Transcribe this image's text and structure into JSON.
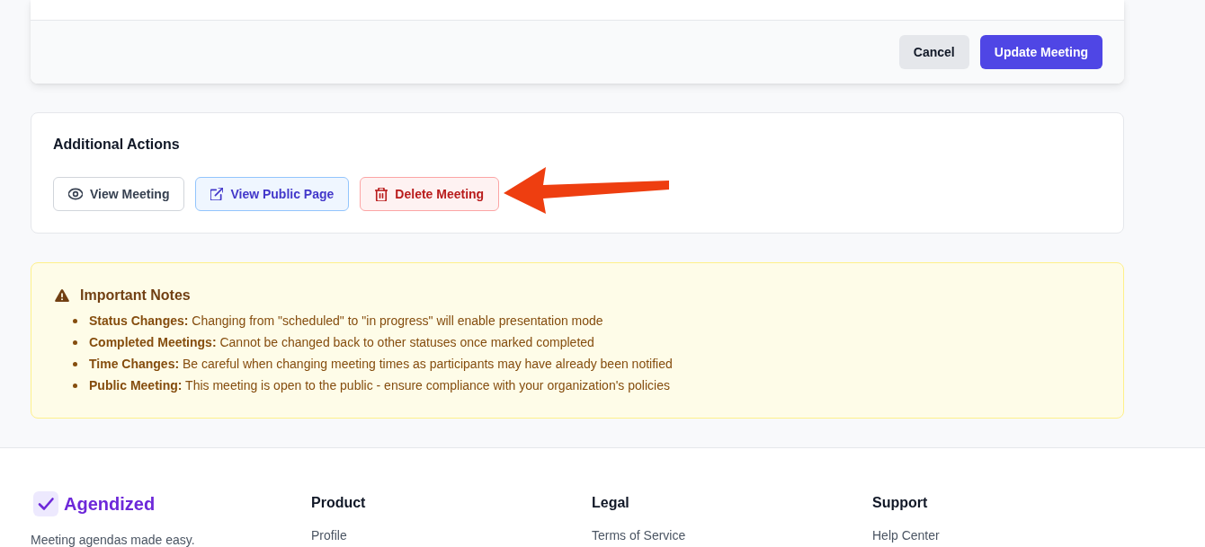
{
  "form_card": {
    "buttons": [
      {
        "label": "Cancel",
        "kind": "secondary"
      },
      {
        "label": "Update Meeting",
        "kind": "primary"
      }
    ]
  },
  "additional_actions": {
    "title": "Additional Actions",
    "buttons": [
      {
        "label": "View Meeting",
        "kind": "view"
      },
      {
        "label": "View Public Page",
        "kind": "public"
      },
      {
        "label": "Delete Meeting",
        "kind": "delete"
      }
    ]
  },
  "important_notes": {
    "title": "Important Notes",
    "items": [
      "**Status Changes:** Changing from \"scheduled\" to \"in progress\" will enable presentation mode",
      "**Completed Meetings:** Cannot be changed back to other statuses once marked completed",
      "**Time Changes:** Be careful when changing meeting times as participants may have already been notified",
      "**Public Meeting:** This meeting is open to the public - ensure compliance with your organization's policies"
    ]
  },
  "footer": {
    "brand": {
      "name": "Agendized",
      "tagline": "Meeting agendas made easy."
    },
    "columns": [
      {
        "heading": "Product",
        "links": [
          "Profile"
        ]
      },
      {
        "heading": "Legal",
        "links": [
          "Terms of Service"
        ]
      },
      {
        "heading": "Support",
        "links": [
          "Help Center"
        ]
      }
    ]
  }
}
